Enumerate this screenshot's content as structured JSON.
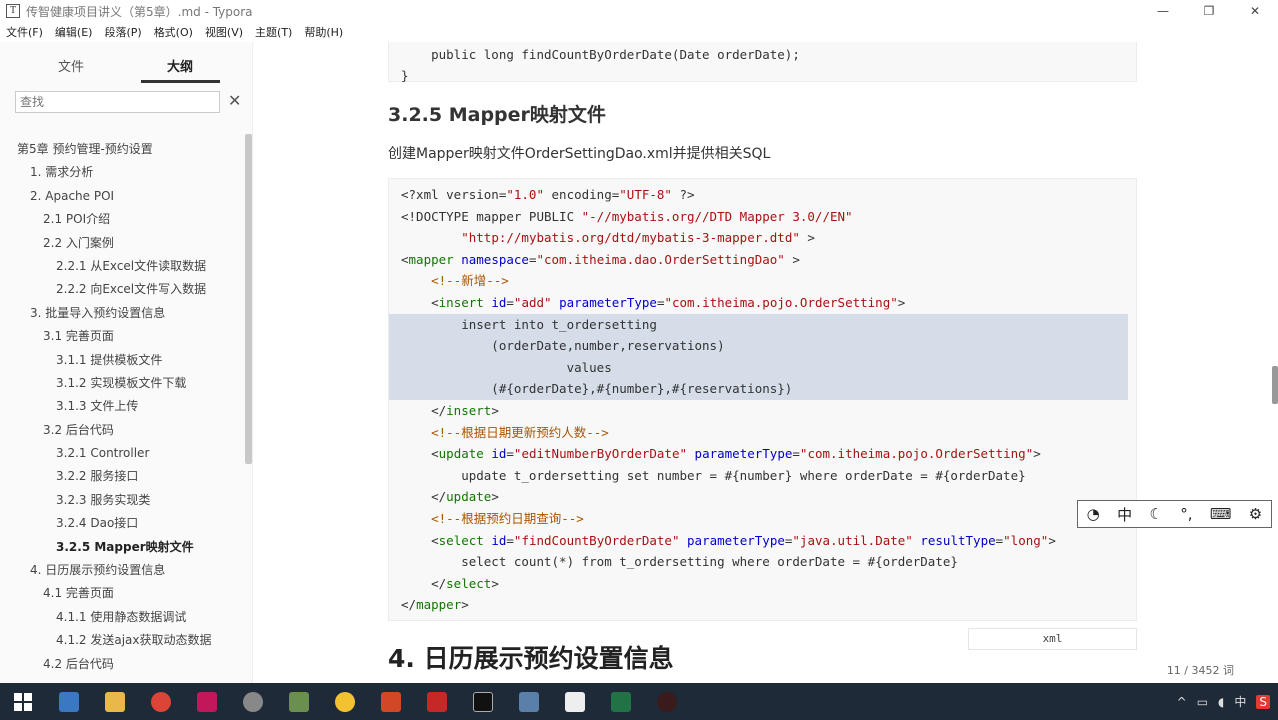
{
  "window": {
    "title": "传智健康项目讲义（第5章）.md - Typora",
    "app_icon": "T",
    "min": "—",
    "max": "❐",
    "close": "✕"
  },
  "menu": [
    "文件(F)",
    "编辑(E)",
    "段落(P)",
    "格式(O)",
    "视图(V)",
    "主题(T)",
    "帮助(H)"
  ],
  "sidebar": {
    "tab_files": "文件",
    "tab_outline": "大纲",
    "search_placeholder": "查找",
    "outline": [
      {
        "label": "第5章 预约管理-预约设置",
        "level": 1
      },
      {
        "label": "1. 需求分析",
        "level": 2
      },
      {
        "label": "2. Apache POI",
        "level": 2
      },
      {
        "label": "2.1 POI介绍",
        "level": 3
      },
      {
        "label": "2.2 入门案例",
        "level": 3
      },
      {
        "label": "2.2.1 从Excel文件读取数据",
        "level": 4
      },
      {
        "label": "2.2.2 向Excel文件写入数据",
        "level": 4
      },
      {
        "label": "3. 批量导入预约设置信息",
        "level": 2
      },
      {
        "label": "3.1 完善页面",
        "level": 3
      },
      {
        "label": "3.1.1 提供模板文件",
        "level": 4
      },
      {
        "label": "3.1.2 实现模板文件下载",
        "level": 4
      },
      {
        "label": "3.1.3 文件上传",
        "level": 4
      },
      {
        "label": "3.2 后台代码",
        "level": 3
      },
      {
        "label": "3.2.1 Controller",
        "level": 4
      },
      {
        "label": "3.2.2 服务接口",
        "level": 4
      },
      {
        "label": "3.2.3 服务实现类",
        "level": 4
      },
      {
        "label": "3.2.4 Dao接口",
        "level": 4
      },
      {
        "label": "3.2.5 Mapper映射文件",
        "level": 4,
        "active": true
      },
      {
        "label": "4. 日历展示预约设置信息",
        "level": 2
      },
      {
        "label": "4.1 完善页面",
        "level": 3
      },
      {
        "label": "4.1.1 使用静态数据调试",
        "level": 4
      },
      {
        "label": "4.1.2 发送ajax获取动态数据",
        "level": 4
      },
      {
        "label": "4.2 后台代码",
        "level": 3
      }
    ],
    "bottom_left": "‹",
    "bottom_code": "</>"
  },
  "main": {
    "code_top": [
      "    public long findCountByOrderDate(Date orderDate);",
      "}"
    ],
    "section_heading": "3.2.5 Mapper映射文件",
    "paragraph": "创建Mapper映射文件OrderSettingDao.xml并提供相关SQL",
    "code_lines": [
      "<?xml version=\"1.0\" encoding=\"UTF-8\" ?>",
      "<!DOCTYPE mapper PUBLIC \"-//mybatis.org//DTD Mapper 3.0//EN\"",
      "        \"http://mybatis.org/dtd/mybatis-3-mapper.dtd\" >",
      "<mapper namespace=\"com.itheima.dao.OrderSettingDao\" >",
      "    <!--新增-->",
      "    <insert id=\"add\" parameterType=\"com.itheima.pojo.OrderSetting\">",
      "        insert into t_ordersetting",
      "            (orderDate,number,reservations)",
      "                      values",
      "            (#{orderDate},#{number},#{reservations})",
      "    </insert>",
      "    <!--根据日期更新预约人数-->",
      "    <update id=\"editNumberByOrderDate\" parameterType=\"com.itheima.pojo.OrderSetting\">",
      "        update t_ordersetting set number = #{number} where orderDate = #{orderDate}",
      "    </update>",
      "    <!--根据预约日期查询-->",
      "    <select id=\"findCountByOrderDate\" parameterType=\"java.util.Date\" resultType=\"long\">",
      "        select count(*) from t_ordersetting where orderDate = #{orderDate}",
      "    </select>",
      "</mapper>"
    ],
    "code_language": "xml",
    "next_heading": "4. 日历展示预约设置信息",
    "word_count": "11 / 3452 词"
  },
  "ime": [
    "中",
    "☾",
    "°,",
    "⌨",
    "⚙"
  ],
  "tray": {
    "chevron": "^",
    "lang": "中"
  }
}
